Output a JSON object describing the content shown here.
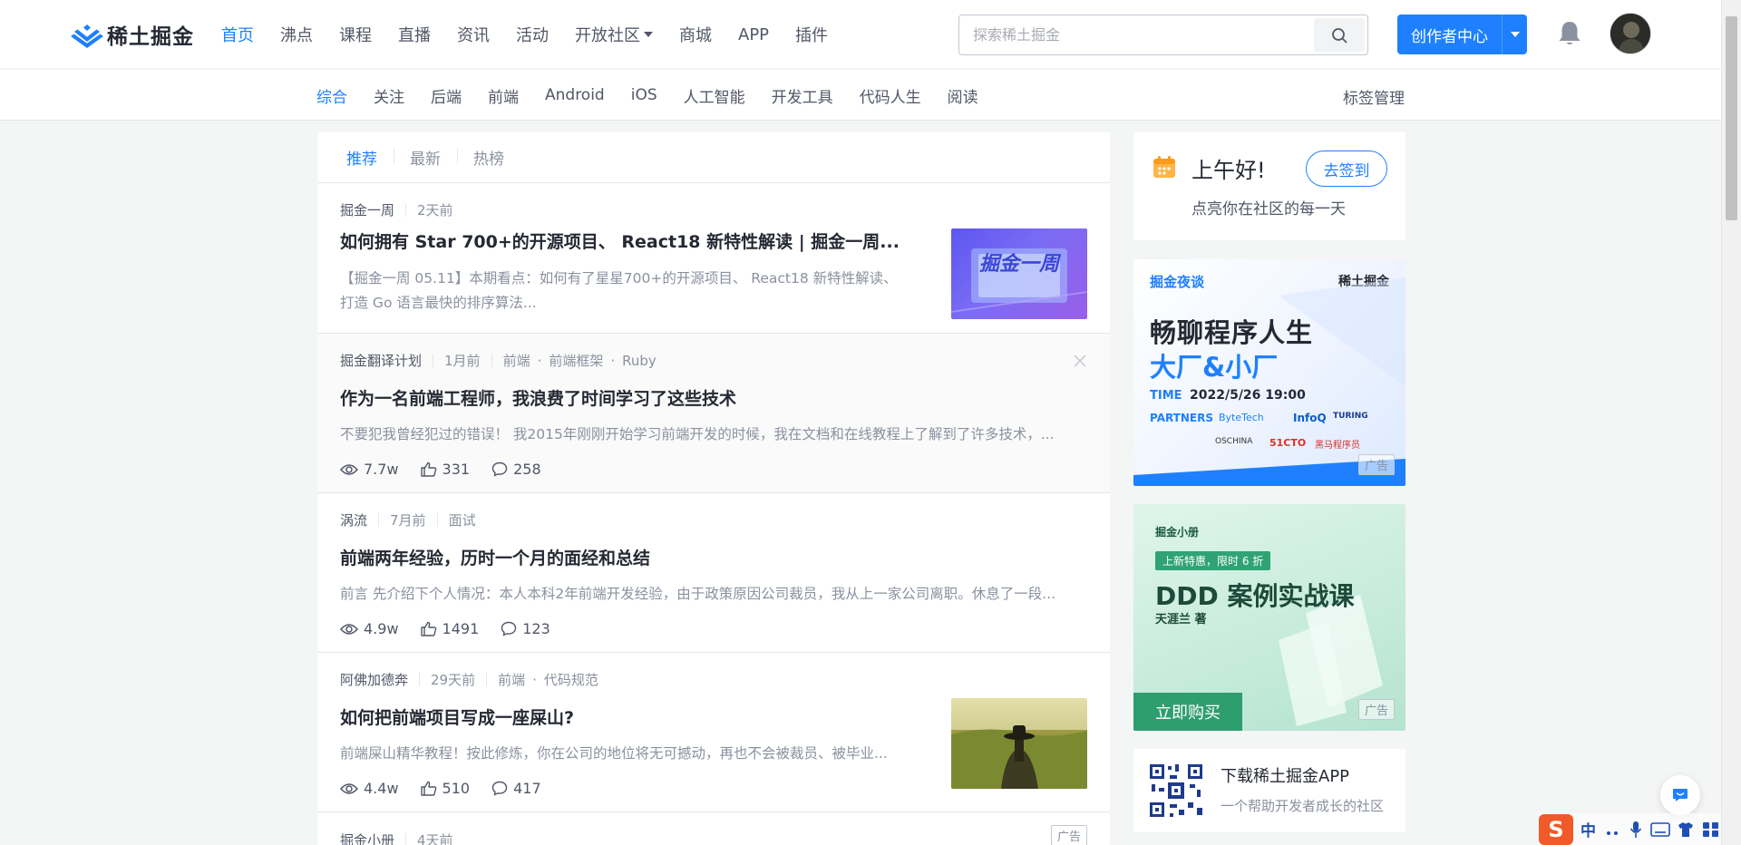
{
  "header": {
    "logo_text": "稀土掘金",
    "nav": [
      {
        "label": "首页",
        "active": true
      },
      {
        "label": "沸点"
      },
      {
        "label": "课程"
      },
      {
        "label": "直播"
      },
      {
        "label": "资讯"
      },
      {
        "label": "活动"
      },
      {
        "label": "开放社区",
        "dropdown": true
      },
      {
        "label": "商城"
      },
      {
        "label": "APP"
      },
      {
        "label": "插件"
      }
    ],
    "search_placeholder": "探索稀土掘金",
    "creator_label": "创作者中心"
  },
  "subnav": {
    "tabs": [
      "综合",
      "关注",
      "后端",
      "前端",
      "Android",
      "iOS",
      "人工智能",
      "开发工具",
      "代码人生",
      "阅读"
    ],
    "active": "综合",
    "tag_manage": "标签管理"
  },
  "feed": {
    "tabs": [
      "推荐",
      "最新",
      "热榜"
    ],
    "articles": [
      {
        "author": "掘金一周",
        "time": "2天前",
        "tags": [],
        "title": "如何拥有 Star 700+的开源项目、 React18 新特性解读 | 掘金一周...",
        "abstract": "【掘金一周 05.11】本期看点：如何有了星星700+的开源项目、 React18 新特性解读、打造 Go 语言最快的排序算法...",
        "thumb_text": "掘金一周"
      },
      {
        "author": "掘金翻译计划",
        "time": "1月前",
        "tags": [
          "前端",
          "前端框架",
          "Ruby"
        ],
        "title": "作为一名前端工程师，我浪费了时间学习了这些技术",
        "abstract": "不要犯我曾经犯过的错误！ 我2015年刚刚开始学习前端开发的时候，我在文档和在线教程上了解到了许多技术，...",
        "views": "7.7w",
        "likes": "331",
        "comments": "258"
      },
      {
        "author": "涡流",
        "time": "7月前",
        "tags": [
          "面试"
        ],
        "title": "前端两年经验，历时一个月的面经和总结",
        "abstract": "前言 先介绍下个人情况：本人本科2年前端开发经验，由于政策原因公司裁员，我从上一家公司离职。休息了一段...",
        "views": "4.9w",
        "likes": "1491",
        "comments": "123"
      },
      {
        "author": "阿佛加德奔",
        "time": "29天前",
        "tags": [
          "前端",
          "代码规范"
        ],
        "title": "如何把前端项目写成一座屎山?",
        "abstract": "前端屎山精华教程！按此修炼，你在公司的地位将无可撼动，再也不会被裁员、被毕业...",
        "views": "4.4w",
        "likes": "510",
        "comments": "417"
      },
      {
        "author": "掘金小册",
        "time": "4天前",
        "ad_label": "广告"
      }
    ]
  },
  "sidebar": {
    "greeting": "上午好!",
    "greeting_sub": "点亮你在社区的每一天",
    "checkin": "去签到",
    "ad1": {
      "brand": "掘金夜谈",
      "brand2": "稀土掘金",
      "headline1": "畅聊程序人生",
      "headline2": "大厂&小厂",
      "time_label": "TIME",
      "time": "2022/5/26 19:00",
      "partners_label": "PARTNERS",
      "partners": [
        "ByteTech",
        "InfoQ",
        "TURING",
        "OSCHINA",
        "51CTO",
        "黑马程序员"
      ],
      "ad_label": "广告"
    },
    "ad2": {
      "brand": "掘金小册",
      "promo": "上新特惠，限时 6 折",
      "headline": "DDD 案例实战课",
      "author": "天涯兰 著",
      "buy": "立即购买",
      "ad_label": "广告"
    },
    "app": {
      "title": "下载稀土掘金APP",
      "sub": "一个帮助开发者成长的社区"
    }
  },
  "ime": {
    "label": "中",
    "icon_letter": "S"
  },
  "colors": {
    "accent": "#1e80ff",
    "text": "#252933",
    "muted": "#8a919f",
    "bg": "#f4f5f5"
  }
}
